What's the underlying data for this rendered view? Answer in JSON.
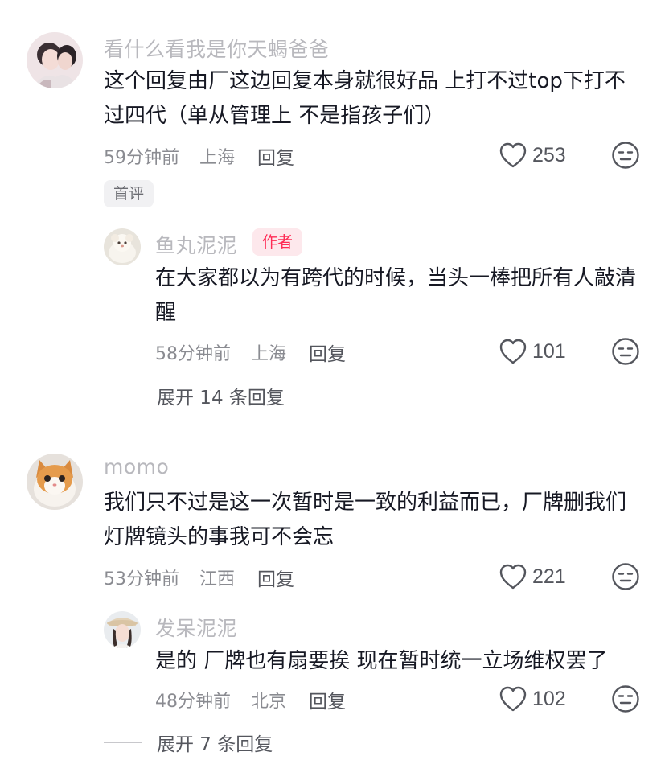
{
  "comments": [
    {
      "username": "看什么看我是你天蝎爸爸",
      "text": "这个回复由厂这边回复本身就很好品 上打不过top下打不过四代（单从管理上 不是指孩子们）",
      "time": "59分钟前",
      "location": "上海",
      "reply_label": "回复",
      "likes": "253",
      "tag": "首评",
      "replies": [
        {
          "username": "鱼丸泥泥",
          "badge": "作者",
          "text": "在大家都以为有跨代的时候，当头一棒把所有人敲清醒",
          "time": "58分钟前",
          "location": "上海",
          "reply_label": "回复",
          "likes": "101"
        }
      ],
      "expand_label": "展开 14 条回复"
    },
    {
      "username": "momo",
      "text": "我们只不过是这一次暂时是一致的利益而已，厂牌删我们灯牌镜头的事我可不会忘",
      "time": "53分钟前",
      "location": "江西",
      "reply_label": "回复",
      "likes": "221",
      "replies": [
        {
          "username": "发呆泥泥",
          "text": "是的 厂牌也有扇要挨 现在暂时统一立场维权罢了",
          "time": "48分钟前",
          "location": "北京",
          "reply_label": "回复",
          "likes": "102"
        }
      ],
      "expand_label": "展开 7 条回复"
    }
  ],
  "icons": {
    "like": "heart-outline-icon",
    "dislike": "neutral-face-icon"
  },
  "colors": {
    "accent": "#fe2c55",
    "badge_bg": "#fde8ec",
    "text": "#161823",
    "meta": "#8a8b91",
    "username": "#b8b8bd"
  }
}
